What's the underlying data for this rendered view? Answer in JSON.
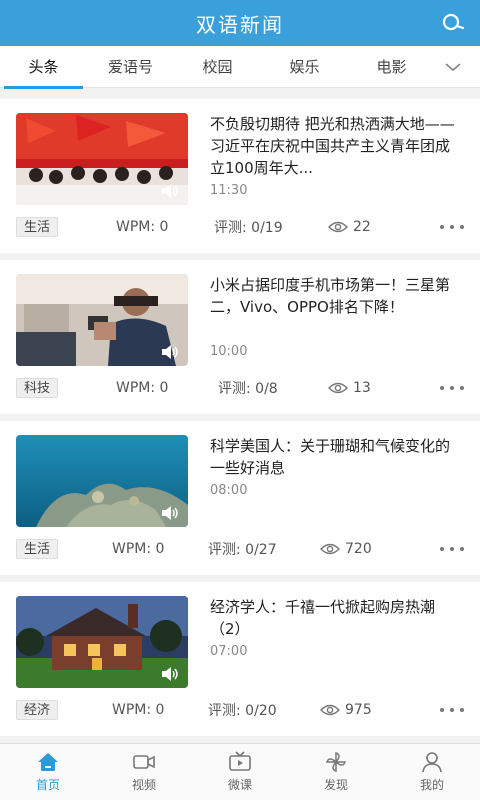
{
  "header": {
    "title": "双语新闻"
  },
  "tabs": [
    {
      "label": "头条"
    },
    {
      "label": "爱语号"
    },
    {
      "label": "校园"
    },
    {
      "label": "娱乐"
    },
    {
      "label": "电影"
    }
  ],
  "articles": [
    {
      "title": "不负殷切期待 把光和热洒满大地——习近平在庆祝中国共产主义青年团成立100周年大...",
      "time": "11:30",
      "tag": "生活",
      "wpm": "WPM: 0",
      "review": "评测: 0/19",
      "views": "22"
    },
    {
      "title": "小米占据印度手机市场第一！三星第二，Vivo、OPPO排名下降！",
      "time": "10:00",
      "tag": "科技",
      "wpm": "WPM: 0",
      "review": "评测: 0/8",
      "views": "13"
    },
    {
      "title": "科学美国人：关于珊瑚和气候变化的一些好消息",
      "time": "08:00",
      "tag": "生活",
      "wpm": "WPM: 0",
      "review": "评测: 0/27",
      "views": "720"
    },
    {
      "title": "经济学人：千禧一代掀起购房热潮（2）",
      "time": "07:00",
      "tag": "经济",
      "wpm": "WPM: 0",
      "review": "评测: 0/20",
      "views": "975"
    }
  ],
  "bottom_nav": [
    {
      "label": "首页",
      "icon": "home-icon"
    },
    {
      "label": "视频",
      "icon": "video-icon"
    },
    {
      "label": "微课",
      "icon": "tv-icon"
    },
    {
      "label": "发现",
      "icon": "pinwheel-icon"
    },
    {
      "label": "我的",
      "icon": "user-icon"
    }
  ],
  "colors": {
    "accent": "#3aa0dc",
    "active_tab": "#2a9bd8"
  }
}
